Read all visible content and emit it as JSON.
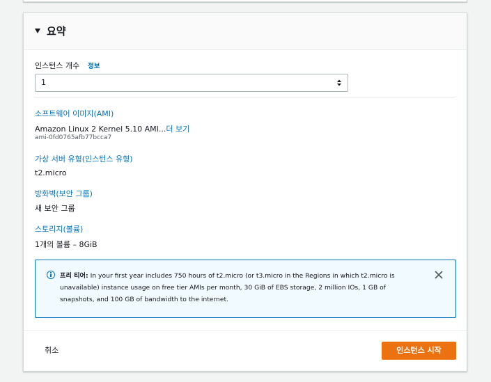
{
  "summary": {
    "title": "요약",
    "instance_count_label": "인스턴스 개수",
    "info_link": "정보",
    "instance_count_value": "1",
    "ami_section_title": "소프트웨어 이미지(AMI)",
    "ami_name": "Amazon Linux 2 Kernel 5.10 AMI...",
    "ami_more_link": "더 보기",
    "ami_id": "ami-0fd0765afb77bcca7",
    "instance_type_title": "가상 서버 유형(인스턴스 유형)",
    "instance_type_value": "t2.micro",
    "firewall_title": "방화벽(보안 그룹)",
    "firewall_value": "새 보안 그룹",
    "storage_title": "스토리지(볼륨)",
    "storage_value": "1개의 볼륨 – 8GiB"
  },
  "free_tier": {
    "label": "프리 티어:",
    "text": " In your first year includes 750 hours of t2.micro (or t3.micro in the Regions in which t2.micro is unavailable) instance usage on free tier AMIs per month, 30 GiB of EBS storage, 2 million IOs, 1 GB of snapshots, and 100 GB of bandwidth to the internet."
  },
  "actions": {
    "cancel_label": "취소",
    "launch_label": "인스턴스 시작"
  },
  "colors": {
    "accent": "#0073bb",
    "primary_button": "#ec7211",
    "info_background": "#f1faff"
  },
  "icons": {
    "caret": "caret-down-icon",
    "info": "info-icon",
    "close": "close-icon",
    "spinner": "spinner-arrows-icon"
  }
}
